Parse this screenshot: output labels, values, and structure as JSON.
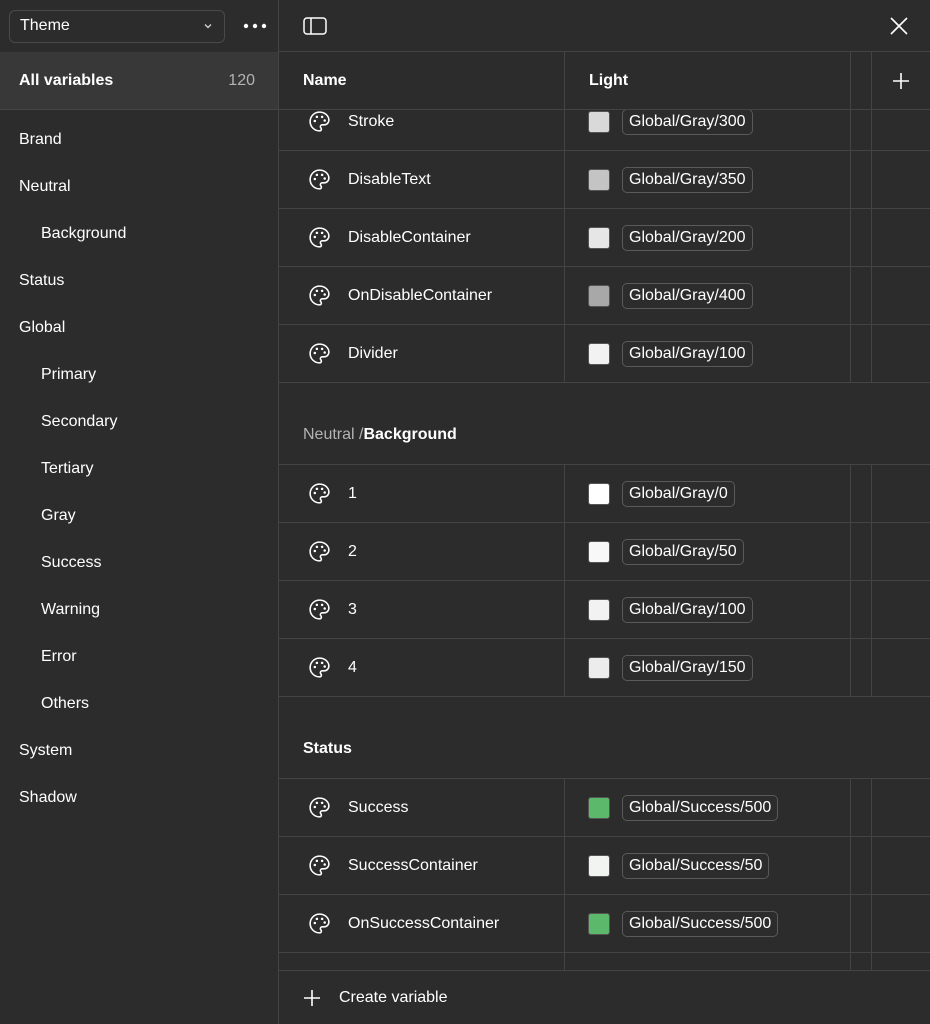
{
  "sidebar": {
    "collection": "Theme",
    "all_variables": {
      "label": "All variables",
      "count": "120"
    },
    "groups": [
      {
        "label": "Brand",
        "level": 0
      },
      {
        "label": "Neutral",
        "level": 0
      },
      {
        "label": "Background",
        "level": 1
      },
      {
        "label": "Status",
        "level": 0
      },
      {
        "label": "Global",
        "level": 0
      },
      {
        "label": "Primary",
        "level": 1
      },
      {
        "label": "Secondary",
        "level": 1
      },
      {
        "label": "Tertiary",
        "level": 1
      },
      {
        "label": "Gray",
        "level": 1
      },
      {
        "label": "Success",
        "level": 1
      },
      {
        "label": "Warning",
        "level": 1
      },
      {
        "label": "Error",
        "level": 1
      },
      {
        "label": "Others",
        "level": 1
      },
      {
        "label": "System",
        "level": 0
      },
      {
        "label": "Shadow",
        "level": 0
      }
    ]
  },
  "table": {
    "col_name": "Name",
    "col_light": "Light",
    "neutral_rows": [
      {
        "name": "Stroke",
        "swatch": "#d9d9d9",
        "alias": "Global/Gray/300"
      },
      {
        "name": "DisableText",
        "swatch": "#c4c4c4",
        "alias": "Global/Gray/350"
      },
      {
        "name": "DisableContainer",
        "swatch": "#e6e6e6",
        "alias": "Global/Gray/200"
      },
      {
        "name": "OnDisableContainer",
        "swatch": "#a8a8a8",
        "alias": "Global/Gray/400"
      },
      {
        "name": "Divider",
        "swatch": "#f2f2f2",
        "alias": "Global/Gray/100"
      }
    ],
    "background_section": {
      "prefix": "Neutral / ",
      "current": "Background"
    },
    "background_rows": [
      {
        "name": "1",
        "swatch": "#ffffff",
        "alias": "Global/Gray/0"
      },
      {
        "name": "2",
        "swatch": "#f8f8f8",
        "alias": "Global/Gray/50"
      },
      {
        "name": "3",
        "swatch": "#f2f2f2",
        "alias": "Global/Gray/100"
      },
      {
        "name": "4",
        "swatch": "#ececec",
        "alias": "Global/Gray/150"
      }
    ],
    "status_section": {
      "current": "Status"
    },
    "status_rows": [
      {
        "name": "Success",
        "swatch": "#5cb86a",
        "alias": "Global/Success/500"
      },
      {
        "name": "SuccessContainer",
        "swatch": "#f2f4f2",
        "alias": "Global/Success/50"
      },
      {
        "name": "OnSuccessContainer",
        "swatch": "#5cb86a",
        "alias": "Global/Success/500"
      }
    ]
  },
  "footer": {
    "create_label": "Create variable"
  }
}
